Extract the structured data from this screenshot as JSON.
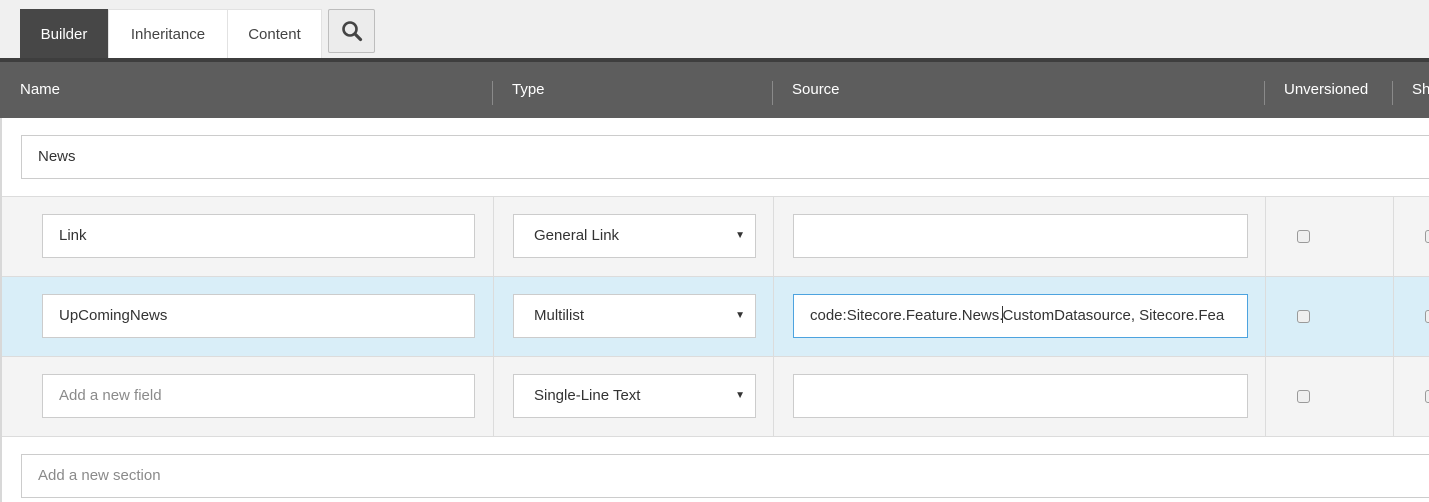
{
  "tabs": [
    {
      "label": "Builder",
      "active": true
    },
    {
      "label": "Inheritance",
      "active": false
    },
    {
      "label": "Content",
      "active": false
    }
  ],
  "search_button": {
    "icon": "search-icon"
  },
  "columns": [
    "Name",
    "Type",
    "Source",
    "Unversioned",
    "Sh"
  ],
  "section": {
    "name": "News"
  },
  "fields": [
    {
      "name": "Link",
      "type": "General Link",
      "source": "",
      "unversioned": false
    },
    {
      "name": "UpComingNews",
      "type": "Multilist",
      "source_before_cursor": "code:Sitecore.Feature.News.",
      "source_after_cursor": "CustomDatasource, Sitecore.Fea",
      "unversioned": false
    }
  ],
  "new_field": {
    "placeholder": "Add a new field",
    "type": "Single-Line Text"
  },
  "new_section": {
    "placeholder": "Add a new section"
  },
  "colors": {
    "active_tab": "#474747",
    "header": "#5d5d5d",
    "selected_row": "#d9eef8",
    "focus_border": "#4da3df"
  }
}
